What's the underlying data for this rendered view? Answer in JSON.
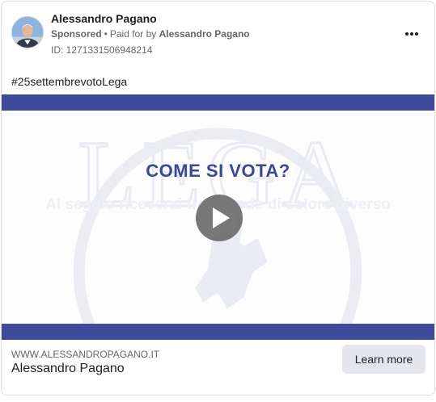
{
  "ad": {
    "page_name": "Alessandro Pagano",
    "sponsored_label": "Sponsored",
    "separator": "•",
    "paid_for_label": "Paid for by",
    "payer_name": "Alessandro Pagano",
    "ad_id": "ID: 1271331506948214",
    "caption": "#25settembrevotoLega"
  },
  "media": {
    "title": "COME SI VOTA?",
    "subtitle": "Al seggio riceverai tre schede di colore diverso",
    "watermark_text": "LEGA",
    "band_color": "#3e4b9b",
    "title_color": "#3b4898"
  },
  "footer": {
    "url": "WWW.ALESSANDROPAGANO.IT",
    "title": "Alessandro Pagano",
    "cta_label": "Learn more"
  },
  "icons": {
    "more": "more-horizontal-icon",
    "play": "play-icon"
  }
}
